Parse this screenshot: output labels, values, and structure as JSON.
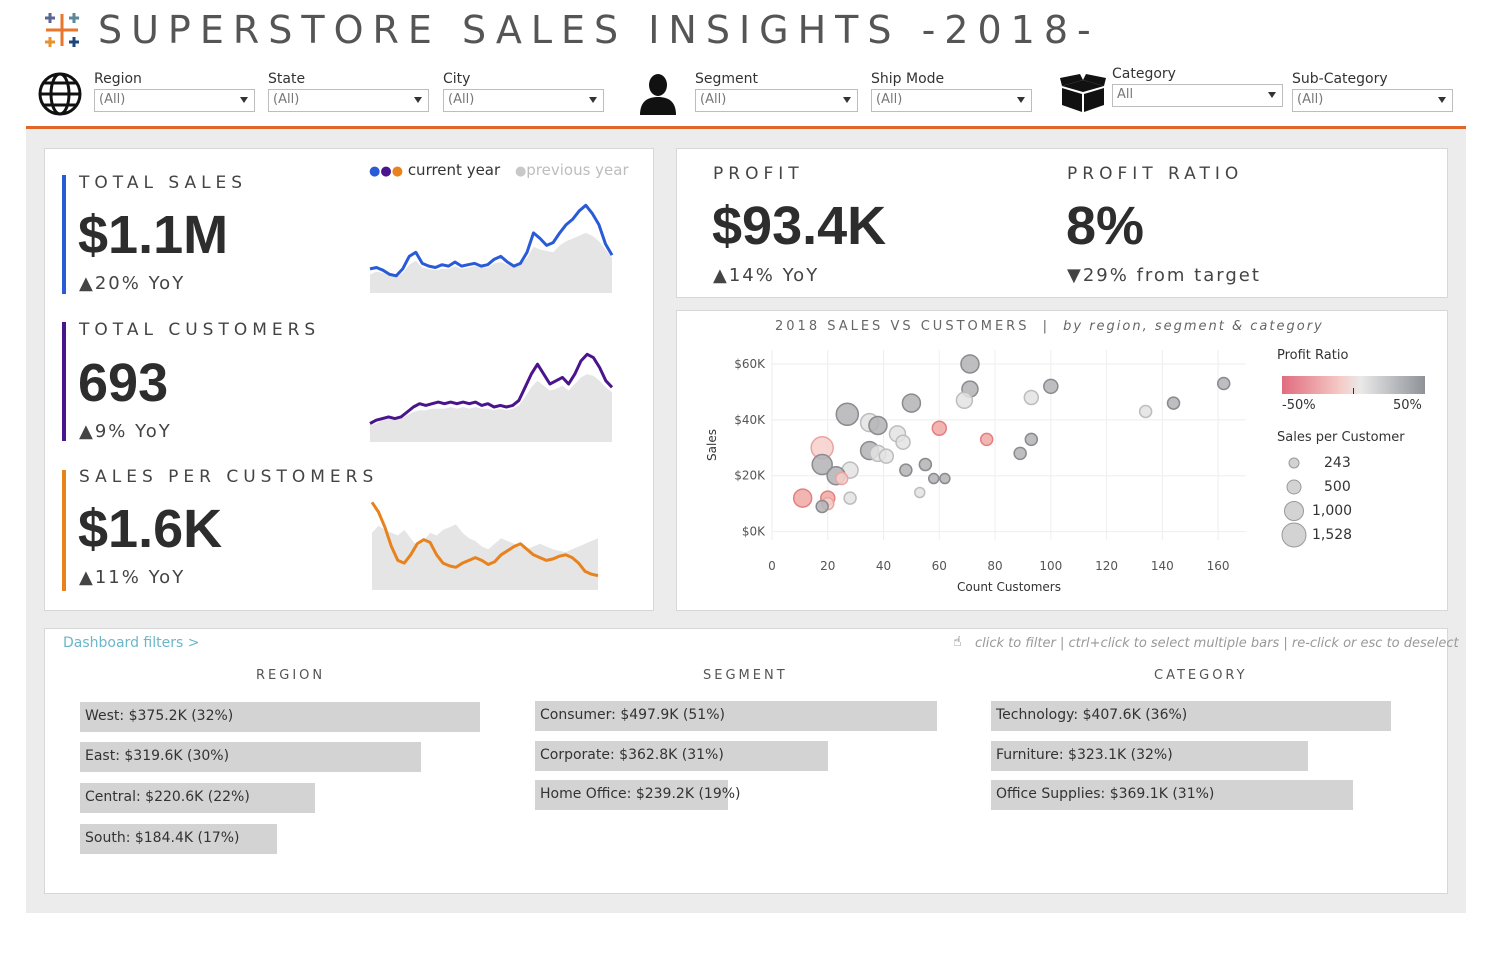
{
  "header": {
    "title": "SUPERSTORE SALES INSIGHTS -2018-"
  },
  "filters": {
    "region": {
      "label": "Region",
      "value": "(All)"
    },
    "state": {
      "label": "State",
      "value": "(All)"
    },
    "city": {
      "label": "City",
      "value": "(All)"
    },
    "segment": {
      "label": "Segment",
      "value": "(All)"
    },
    "ship_mode": {
      "label": "Ship Mode",
      "value": "(All)"
    },
    "category": {
      "label": "Category",
      "value": "All"
    },
    "sub_category": {
      "label": "Sub-Category",
      "value": "(All)"
    }
  },
  "legend": {
    "current": "current year",
    "previous": "previous year",
    "current_colors": [
      "#2a5bd7",
      "#4a148c",
      "#e8821e"
    ],
    "previous_color": "#cfcfcf"
  },
  "kpis": {
    "sales": {
      "label": "TOTAL SALES",
      "value": "$1.1M",
      "yoy": "▲20% YoY",
      "color": "#2a5bd7"
    },
    "customers": {
      "label": "TOTAL CUSTOMERS",
      "value": "693",
      "yoy": "▲9% YoY",
      "color": "#4a148c"
    },
    "spc": {
      "label": "SALES PER CUSTOMERS",
      "value": "$1.6K",
      "yoy": "▲11% YoY",
      "color": "#e8821e"
    },
    "profit": {
      "label": "PROFIT",
      "value": "$93.4K",
      "yoy": "▲14% YoY"
    },
    "ratio": {
      "label": "PROFIT RATIO",
      "value": "8%",
      "target": "▼29% from target"
    }
  },
  "scatter": {
    "title": "2018 SALES VS CUSTOMERS",
    "subtitle": "by region, segment & category",
    "separator": "|",
    "legend": {
      "ratio_title": "Profit Ratio",
      "ratio_min": "-50%",
      "ratio_max": "50%",
      "size_title": "Sales per Customer",
      "sizes": [
        "243",
        "500",
        "1,000",
        "1,528"
      ]
    }
  },
  "bottom": {
    "link": "Dashboard filters >",
    "hint": "click to filter | ctrl+click to select multiple bars | re-click or esc to deselect",
    "region": {
      "title": "REGION",
      "bars": [
        {
          "name": "West:",
          "text": "$375.2K (32%)",
          "value": 375.2
        },
        {
          "name": "East:",
          "text": "$319.6K (30%)",
          "value": 319.6
        },
        {
          "name": "Central:",
          "text": "$220.6K (22%)",
          "value": 220.6
        },
        {
          "name": "South:",
          "text": "$184.4K (17%)",
          "value": 184.4
        }
      ]
    },
    "segment": {
      "title": "SEGMENT",
      "bars": [
        {
          "name": "Consumer:",
          "text": "$497.9K (51%)",
          "value": 497.9
        },
        {
          "name": "Corporate:",
          "text": "$362.8K (31%)",
          "value": 362.8
        },
        {
          "name": "Home Office:",
          "text": "$239.2K (19%)",
          "value": 239.2
        }
      ]
    },
    "category": {
      "title": "CATEGORY",
      "bars": [
        {
          "name": "Technology:",
          "text": "$407.6K (36%)",
          "value": 407.6
        },
        {
          "name": "Furniture:",
          "text": "$323.1K (32%)",
          "value": 323.1
        },
        {
          "name": "Office Supplies:",
          "text": "$369.1K (31%)",
          "value": 369.1
        }
      ]
    }
  },
  "chart_data": [
    {
      "type": "area",
      "name": "Total Sales sparkline",
      "series": [
        {
          "name": "current year",
          "values": [
            16,
            17,
            15,
            12,
            11,
            16,
            25,
            28,
            20,
            18,
            17,
            19,
            18,
            21,
            18,
            19,
            20,
            18,
            19,
            23,
            25,
            21,
            18,
            20,
            28,
            42,
            38,
            33,
            35,
            42,
            48,
            52,
            58,
            62,
            56,
            48,
            34,
            26
          ]
        },
        {
          "name": "previous year",
          "values": [
            12,
            14,
            13,
            11,
            10,
            13,
            19,
            22,
            17,
            16,
            15,
            16,
            16,
            18,
            16,
            17,
            18,
            17,
            17,
            20,
            21,
            19,
            18,
            19,
            24,
            32,
            30,
            29,
            28,
            33,
            36,
            38,
            40,
            42,
            40,
            36,
            30,
            24
          ]
        }
      ]
    },
    {
      "type": "area",
      "name": "Total Customers sparkline",
      "series": [
        {
          "name": "current year",
          "values": [
            10,
            12,
            13,
            14,
            13,
            14,
            17,
            20,
            22,
            21,
            22,
            23,
            22,
            23,
            22,
            23,
            22,
            23,
            21,
            22,
            20,
            21,
            20,
            21,
            24,
            32,
            40,
            46,
            40,
            34,
            36,
            38,
            34,
            40,
            48,
            52,
            50,
            44,
            36,
            32
          ]
        },
        {
          "name": "previous year",
          "values": [
            9,
            10,
            12,
            13,
            12,
            13,
            15,
            17,
            18,
            18,
            19,
            19,
            19,
            20,
            19,
            20,
            19,
            20,
            19,
            19,
            18,
            19,
            18,
            19,
            21,
            26,
            32,
            36,
            33,
            30,
            31,
            33,
            30,
            34,
            38,
            40,
            39,
            36,
            32,
            29
          ]
        }
      ]
    },
    {
      "type": "area",
      "name": "Sales per Customers sparkline",
      "series": [
        {
          "name": "current year",
          "values": [
            62,
            55,
            44,
            30,
            20,
            18,
            24,
            32,
            35,
            33,
            24,
            18,
            16,
            15,
            18,
            20,
            22,
            20,
            17,
            19,
            24,
            27,
            30,
            32,
            28,
            24,
            22,
            20,
            21,
            23,
            24,
            22,
            18,
            12,
            10,
            9
          ]
        },
        {
          "name": "previous year",
          "values": [
            40,
            45,
            42,
            40,
            38,
            42,
            36,
            30,
            34,
            40,
            38,
            42,
            44,
            46,
            40,
            36,
            34,
            30,
            28,
            32,
            36,
            34,
            32,
            30,
            28,
            30,
            32,
            30,
            28,
            27,
            26,
            28,
            30,
            32,
            34,
            36
          ]
        }
      ]
    },
    {
      "type": "scatter",
      "xlabel": "Count Customers",
      "ylabel": "Sales",
      "xticks": [
        "0",
        "20",
        "40",
        "60",
        "80",
        "100",
        "120",
        "140",
        "160"
      ],
      "yticks": [
        "$0K",
        "$20K",
        "$40K",
        "$60K"
      ],
      "xlim": [
        0,
        170
      ],
      "ylim": [
        -3,
        65
      ],
      "points": [
        {
          "x": 71,
          "y": 60,
          "r": 9,
          "ratio": "neg"
        },
        {
          "x": 71,
          "y": 51,
          "r": 8,
          "ratio": "neg"
        },
        {
          "x": 100,
          "y": 52,
          "r": 7,
          "ratio": "neg"
        },
        {
          "x": 162,
          "y": 53,
          "r": 6,
          "ratio": "neg"
        },
        {
          "x": 93,
          "y": 48,
          "r": 7,
          "ratio": "pos"
        },
        {
          "x": 69,
          "y": 47,
          "r": 8,
          "ratio": "pos"
        },
        {
          "x": 50,
          "y": 46,
          "r": 9,
          "ratio": "neg"
        },
        {
          "x": 144,
          "y": 46,
          "r": 6,
          "ratio": "neg"
        },
        {
          "x": 134,
          "y": 43,
          "r": 6,
          "ratio": "pos"
        },
        {
          "x": 27,
          "y": 42,
          "r": 11,
          "ratio": "neg"
        },
        {
          "x": 35,
          "y": 39,
          "r": 9,
          "ratio": "pos"
        },
        {
          "x": 38,
          "y": 38,
          "r": 9,
          "ratio": "neg"
        },
        {
          "x": 60,
          "y": 37,
          "r": 7,
          "ratio": "red"
        },
        {
          "x": 45,
          "y": 35,
          "r": 8,
          "ratio": "pos"
        },
        {
          "x": 47,
          "y": 32,
          "r": 7,
          "ratio": "pos"
        },
        {
          "x": 77,
          "y": 33,
          "r": 6,
          "ratio": "red"
        },
        {
          "x": 93,
          "y": 33,
          "r": 6,
          "ratio": "neg"
        },
        {
          "x": 18,
          "y": 30,
          "r": 11,
          "ratio": "pink"
        },
        {
          "x": 35,
          "y": 29,
          "r": 9,
          "ratio": "neg"
        },
        {
          "x": 38,
          "y": 28,
          "r": 8,
          "ratio": "pos"
        },
        {
          "x": 41,
          "y": 27,
          "r": 7,
          "ratio": "pos"
        },
        {
          "x": 89,
          "y": 28,
          "r": 6,
          "ratio": "neg"
        },
        {
          "x": 18,
          "y": 24,
          "r": 10,
          "ratio": "neg"
        },
        {
          "x": 55,
          "y": 24,
          "r": 6,
          "ratio": "neg"
        },
        {
          "x": 48,
          "y": 22,
          "r": 6,
          "ratio": "neg"
        },
        {
          "x": 28,
          "y": 22,
          "r": 8,
          "ratio": "pos"
        },
        {
          "x": 23,
          "y": 20,
          "r": 9,
          "ratio": "neg"
        },
        {
          "x": 25,
          "y": 19,
          "r": 6,
          "ratio": "pink"
        },
        {
          "x": 58,
          "y": 19,
          "r": 5,
          "ratio": "neg"
        },
        {
          "x": 62,
          "y": 19,
          "r": 5,
          "ratio": "neg"
        },
        {
          "x": 53,
          "y": 14,
          "r": 5,
          "ratio": "pos"
        },
        {
          "x": 11,
          "y": 12,
          "r": 9,
          "ratio": "red"
        },
        {
          "x": 20,
          "y": 12,
          "r": 7,
          "ratio": "red"
        },
        {
          "x": 20,
          "y": 10,
          "r": 6,
          "ratio": "pink"
        },
        {
          "x": 28,
          "y": 12,
          "r": 6,
          "ratio": "pos"
        },
        {
          "x": 18,
          "y": 9,
          "r": 6,
          "ratio": "neg"
        }
      ]
    }
  ]
}
